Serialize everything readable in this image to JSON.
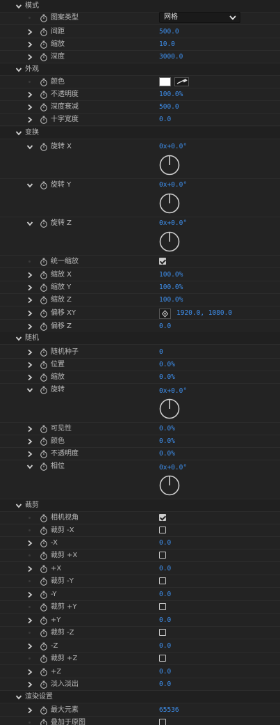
{
  "sections": {
    "mode": "模式",
    "appearance": "外观",
    "transform": "变换",
    "random": "随机",
    "crop": "裁剪",
    "render": "渲染设置"
  },
  "mode": {
    "pattern_type_label": "图案类型",
    "pattern_type_value": "网格",
    "spacing_label": "间距",
    "spacing_value": "500.0",
    "scale_label": "缩放",
    "scale_value": "10.0",
    "depth_label": "深度",
    "depth_value": "3000.0"
  },
  "appearance": {
    "color_label": "颜色",
    "color_value": "#ffffff",
    "opacity_label": "不透明度",
    "opacity_value": "100.0%",
    "depth_falloff_label": "深度衰减",
    "depth_falloff_value": "500.0",
    "cross_width_label": "十字宽度",
    "cross_width_value": "0.0"
  },
  "transform": {
    "rotate_x_label": "旋转 X",
    "rotate_x_value": "0x+0.0°",
    "rotate_y_label": "旋转 Y",
    "rotate_y_value": "0x+0.0°",
    "rotate_z_label": "旋转 Z",
    "rotate_z_value": "0x+0.0°",
    "uniform_scale_label": "统一缩放",
    "uniform_scale_checked": true,
    "scale_x_label": "缩放 X",
    "scale_x_value": "100.0%",
    "scale_y_label": "缩放 Y",
    "scale_y_value": "100.0%",
    "scale_z_label": "缩放 Z",
    "scale_z_value": "100.0%",
    "offset_xy_label": "偏移 XY",
    "offset_xy_value": "1920.0, 1080.0",
    "offset_z_label": "偏移 Z",
    "offset_z_value": "0.0"
  },
  "random": {
    "seed_label": "随机种子",
    "seed_value": "0",
    "position_label": "位置",
    "position_value": "0.0%",
    "scale_label": "缩放",
    "scale_value": "0.0%",
    "rotation_label": "旋转",
    "rotation_value": "0x+0.0°",
    "visibility_label": "可见性",
    "visibility_value": "0.0%",
    "color_label": "颜色",
    "color_value": "0.0%",
    "opacity_label": "不透明度",
    "opacity_value": "0.0%",
    "phase_label": "相位",
    "phase_value": "0x+0.0°"
  },
  "crop": {
    "camera_view_label": "相机视角",
    "camera_view_checked": true,
    "crop_neg_x_label": "裁剪 -X",
    "crop_neg_x_checked": false,
    "neg_x_label": "-X",
    "neg_x_value": "0.0",
    "crop_pos_x_label": "裁剪 +X",
    "crop_pos_x_checked": false,
    "pos_x_label": "+X",
    "pos_x_value": "0.0",
    "crop_neg_y_label": "裁剪 -Y",
    "crop_neg_y_checked": false,
    "neg_y_label": "-Y",
    "neg_y_value": "0.0",
    "crop_pos_y_label": "裁剪 +Y",
    "crop_pos_y_checked": false,
    "pos_y_label": "+Y",
    "pos_y_value": "0.0",
    "crop_neg_z_label": "裁剪 -Z",
    "crop_neg_z_checked": false,
    "neg_z_label": "-Z",
    "neg_z_value": "0.0",
    "crop_pos_z_label": "裁剪 +Z",
    "crop_pos_z_checked": false,
    "pos_z_label": "+Z",
    "pos_z_value": "0.0",
    "fade_label": "淡入淡出",
    "fade_value": "0.0"
  },
  "render": {
    "max_elements_label": "最大元素",
    "max_elements_value": "65536",
    "overlay_label": "叠加于原图",
    "overlay_checked": false
  },
  "colors": {
    "value_blue": "#3e90ef",
    "panel_bg": "#232323",
    "section_bg": "#202020"
  }
}
